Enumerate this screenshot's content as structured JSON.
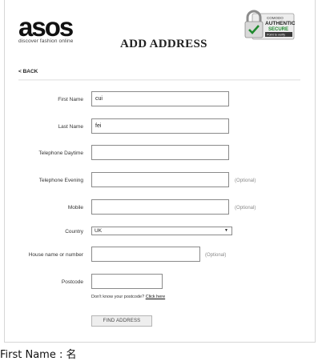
{
  "brand": {
    "name": "asos",
    "tagline": "discover fashion online"
  },
  "page_title": "ADD ADDRESS",
  "badge": {
    "line1": "COMODO",
    "line2": "AUTHENTIC",
    "line3": "SECURE",
    "line4": "Point to verify",
    "icon": "padlock-check-icon"
  },
  "back_link": "< BACK",
  "fields": {
    "first_name": {
      "label": "First Name",
      "value": "cui"
    },
    "last_name": {
      "label": "Last Name",
      "value": "fei"
    },
    "tel_day": {
      "label": "Telephone Daytime",
      "value": ""
    },
    "tel_eve": {
      "label": "Telephone Evening",
      "value": "",
      "optional": "(Optional)"
    },
    "mobile": {
      "label": "Mobile",
      "value": "",
      "optional": "(Optional)"
    },
    "country": {
      "label": "Country",
      "value": "UK"
    },
    "house": {
      "label": "House name or number",
      "value": "",
      "optional": "(Optional)"
    },
    "postcode": {
      "label": "Postcode",
      "value": ""
    }
  },
  "postcode_hint": {
    "text": "Don't know your postcode?",
    "link": "Click here"
  },
  "find_button": "FIND ADDRESS",
  "caption": "First Name : 名"
}
